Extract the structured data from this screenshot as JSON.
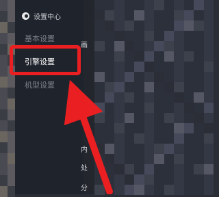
{
  "sidebar": {
    "title": "设置中心",
    "items": [
      {
        "label": "基本设置",
        "active": false
      },
      {
        "label": "引擎设置",
        "active": true
      },
      {
        "label": "机型设置",
        "active": false
      }
    ]
  },
  "content_labels": [
    "画",
    "内",
    "处",
    "分"
  ],
  "colors": {
    "annotation": "#ea1f22",
    "sidebar_bg": "#1f232b"
  },
  "icons": [
    "logo-icon"
  ]
}
